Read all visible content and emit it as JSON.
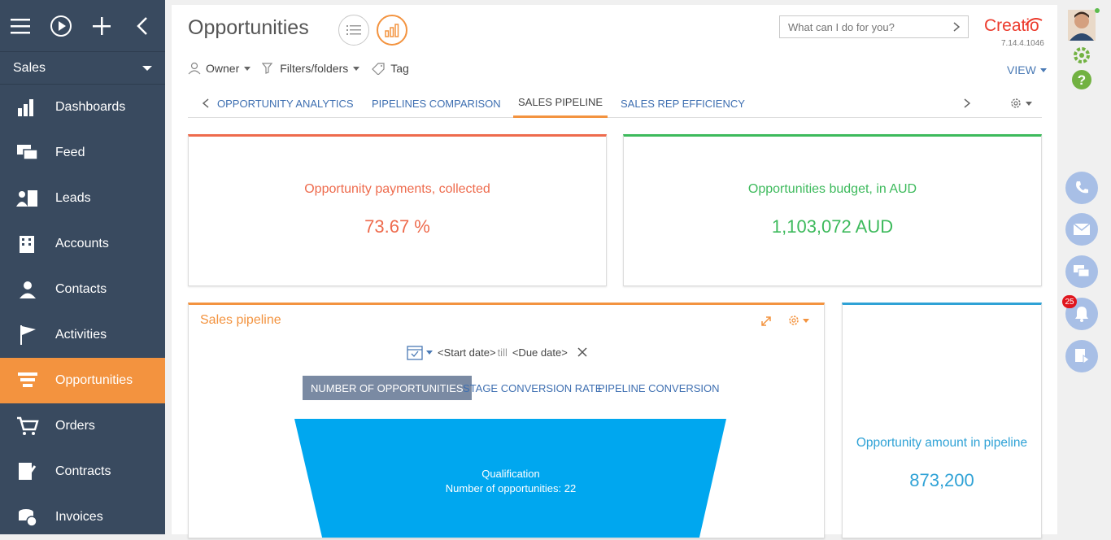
{
  "sidebar": {
    "workplace": "Sales",
    "items": [
      {
        "label": "Dashboards",
        "icon": "dashboards-icon",
        "active": false
      },
      {
        "label": "Feed",
        "icon": "feed-icon",
        "active": false
      },
      {
        "label": "Leads",
        "icon": "leads-icon",
        "active": false
      },
      {
        "label": "Accounts",
        "icon": "accounts-icon",
        "active": false
      },
      {
        "label": "Contacts",
        "icon": "contacts-icon",
        "active": false
      },
      {
        "label": "Activities",
        "icon": "activities-icon",
        "active": false
      },
      {
        "label": "Opportunities",
        "icon": "opportunities-icon",
        "active": true
      },
      {
        "label": "Orders",
        "icon": "orders-icon",
        "active": false
      },
      {
        "label": "Contracts",
        "icon": "contracts-icon",
        "active": false
      },
      {
        "label": "Invoices",
        "icon": "invoices-icon",
        "active": false
      }
    ]
  },
  "header": {
    "title": "Opportunities",
    "search_placeholder": "What can I do for you?",
    "logo": "Creatio",
    "version": "7.14.4.1046",
    "view_label": "VIEW"
  },
  "filters": {
    "owner": "Owner",
    "filters_folders": "Filters/folders",
    "tag": "Tag"
  },
  "tabs": [
    {
      "label": "OPPORTUNITY ANALYTICS",
      "active": false
    },
    {
      "label": "PIPELINES COMPARISON",
      "active": false
    },
    {
      "label": "SALES PIPELINE",
      "active": true
    },
    {
      "label": "SALES REP EFFICIENCY",
      "active": false
    }
  ],
  "metrics": {
    "payments": {
      "label": "Opportunity payments, collected",
      "value": "73.67 %",
      "color": "#ee6b4d"
    },
    "budget": {
      "label": "Opportunities budget, in AUD",
      "value": "1,103,072 AUD",
      "color": "#3dba5c"
    },
    "amount": {
      "label": "Opportunity amount in pipeline",
      "value": "873,200",
      "color": "#2fa2d6"
    }
  },
  "pipeline": {
    "title": "Sales pipeline",
    "start_date": "<Start date>",
    "till": "till",
    "due_date": "<Due date>",
    "subtabs": [
      {
        "label": "NUMBER OF OPPORTUNITIES",
        "active": true
      },
      {
        "label": "STAGE CONVERSION RATE",
        "active": false
      },
      {
        "label": "PIPELINE CONVERSION",
        "active": false
      }
    ],
    "funnel_stage": "Qualification",
    "funnel_value": "Number of opportunities: 22",
    "funnel_color": "#00a7ef"
  },
  "notifications": {
    "count": "25"
  },
  "colors": {
    "sidebar": "#394a5f",
    "accent": "#f3933f",
    "link": "#3e6fb1"
  }
}
